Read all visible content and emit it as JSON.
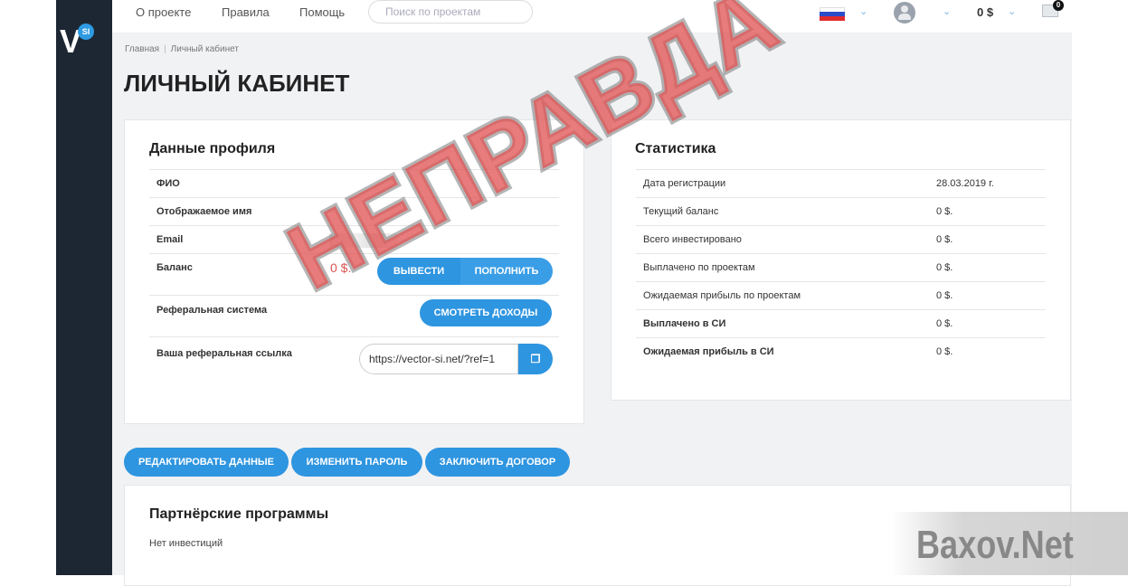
{
  "brand": {
    "logo_letter": "V",
    "logo_badge": "SI"
  },
  "nav": {
    "items": [
      "О проекте",
      "Правила",
      "Помощь"
    ]
  },
  "search": {
    "placeholder": "Поиск по проектам"
  },
  "header": {
    "balance": "0 $",
    "mail_count": "0"
  },
  "breadcrumb": {
    "home": "Главная",
    "current": "Личный кабинет"
  },
  "page_title": "ЛИЧНЫЙ КАБИНЕТ",
  "profile": {
    "title": "Данные профиля",
    "rows": {
      "fio": "ФИО",
      "display_name": "Отображаемое имя",
      "email": "Email",
      "balance": "Баланс",
      "referral": "Реферальная система",
      "ref_link": "Ваша реферальная ссылка"
    },
    "balance_value": "0 $.",
    "withdraw_button": "ВЫВЕСТИ",
    "deposit_button": "ПОПОЛНИТЬ",
    "earnings_button": "СМОТРЕТЬ ДОХОДЫ",
    "ref_link_value": "https://vector-si.net/?ref=1",
    "copy_icon": "copy-icon"
  },
  "stats": {
    "title": "Статистика",
    "rows": [
      {
        "label": "Дата регистрации",
        "value": "28.03.2019 г."
      },
      {
        "label": "Текущий баланс",
        "value": "0 $."
      },
      {
        "label": "Всего инвестировано",
        "value": "0 $."
      },
      {
        "label": "Выплачено по проектам",
        "value": "0 $."
      },
      {
        "label": "Ожидаемая прибыль по проектам",
        "value": "0 $."
      },
      {
        "label": "Выплачено в СИ",
        "value": "0 $."
      },
      {
        "label": "Ожидаемая прибыль в СИ",
        "value": "0 $."
      }
    ]
  },
  "actions": {
    "edit": "РЕДАКТИРОВАТЬ ДАННЫЕ",
    "password": "ИЗМЕНИТЬ ПАРОЛЬ",
    "contract": "ЗАКЛЮЧИТЬ ДОГОВОР"
  },
  "partners": {
    "title": "Партнёрские программы",
    "empty": "Нет инвестиций"
  },
  "overlay": {
    "stamp": "НЕПРАВДА",
    "watermark": "Baxov.Net"
  },
  "colors": {
    "accent": "#2e95e0",
    "sidebar": "#1d2733",
    "stamp": "#e25656",
    "balance_red": "#d9534f"
  }
}
